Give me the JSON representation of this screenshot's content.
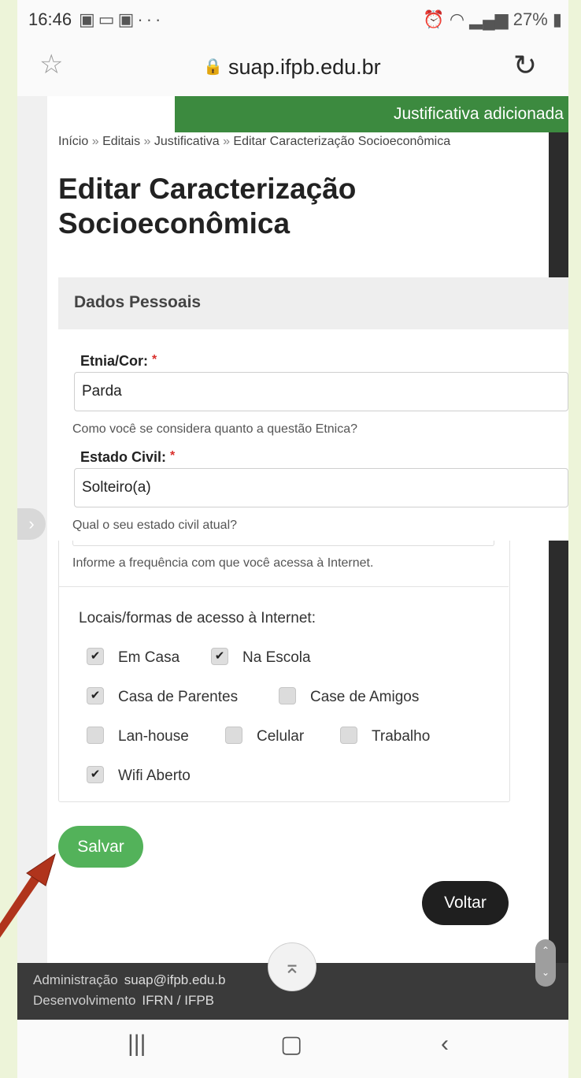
{
  "status_bar": {
    "time": "16:46",
    "left_icons": [
      "image-icon",
      "screen-icon",
      "gallery-icon",
      "more-dots-icon"
    ],
    "right_text": "27%"
  },
  "browser": {
    "url": "suap.ifpb.edu.br"
  },
  "toast": {
    "text": "Justificativa adicionada c"
  },
  "breadcrumb": {
    "items": [
      "Início",
      "Editais",
      "Justificativa",
      "Editar Caracterização Socioeconômica"
    ],
    "separator": "»"
  },
  "page_title": "Editar Caracterização Socioeconômica",
  "section": {
    "title": "Dados Pessoais"
  },
  "fields": {
    "etnia": {
      "label": "Etnia/Cor:",
      "required_mark": "*",
      "value": "Parda",
      "help": "Como você se considera quanto a questão Etnica?"
    },
    "estado_civil": {
      "label": "Estado Civil:",
      "required_mark": "*",
      "value": "Solteiro(a)",
      "help": "Qual o seu estado civil atual?"
    },
    "frequencia_help": "Informe a frequência com que você acessa à Internet."
  },
  "internet_access": {
    "title": "Locais/formas de acesso à Internet:",
    "options": [
      {
        "label": "Em Casa",
        "checked": true
      },
      {
        "label": "Na Escola",
        "checked": true
      },
      {
        "label": "Casa de Parentes",
        "checked": true
      },
      {
        "label": "Case de Amigos",
        "checked": false
      },
      {
        "label": "Lan-house",
        "checked": false
      },
      {
        "label": "Celular",
        "checked": false
      },
      {
        "label": "Trabalho",
        "checked": false
      },
      {
        "label": "Wifi Aberto",
        "checked": true
      }
    ]
  },
  "buttons": {
    "save": "Salvar",
    "back": "Voltar"
  },
  "footer": {
    "row1_label": "Administração",
    "row1_value": "suap@ifpb.edu.b",
    "row2_label": "Desenvolvimento",
    "row2_value": "IFRN / IFPB"
  },
  "colors": {
    "toast": "#3c8a3f",
    "save_button": "#53b25a",
    "back_button": "#1f1f1f",
    "required": "#d9302c",
    "arrow": "#b0341c"
  }
}
